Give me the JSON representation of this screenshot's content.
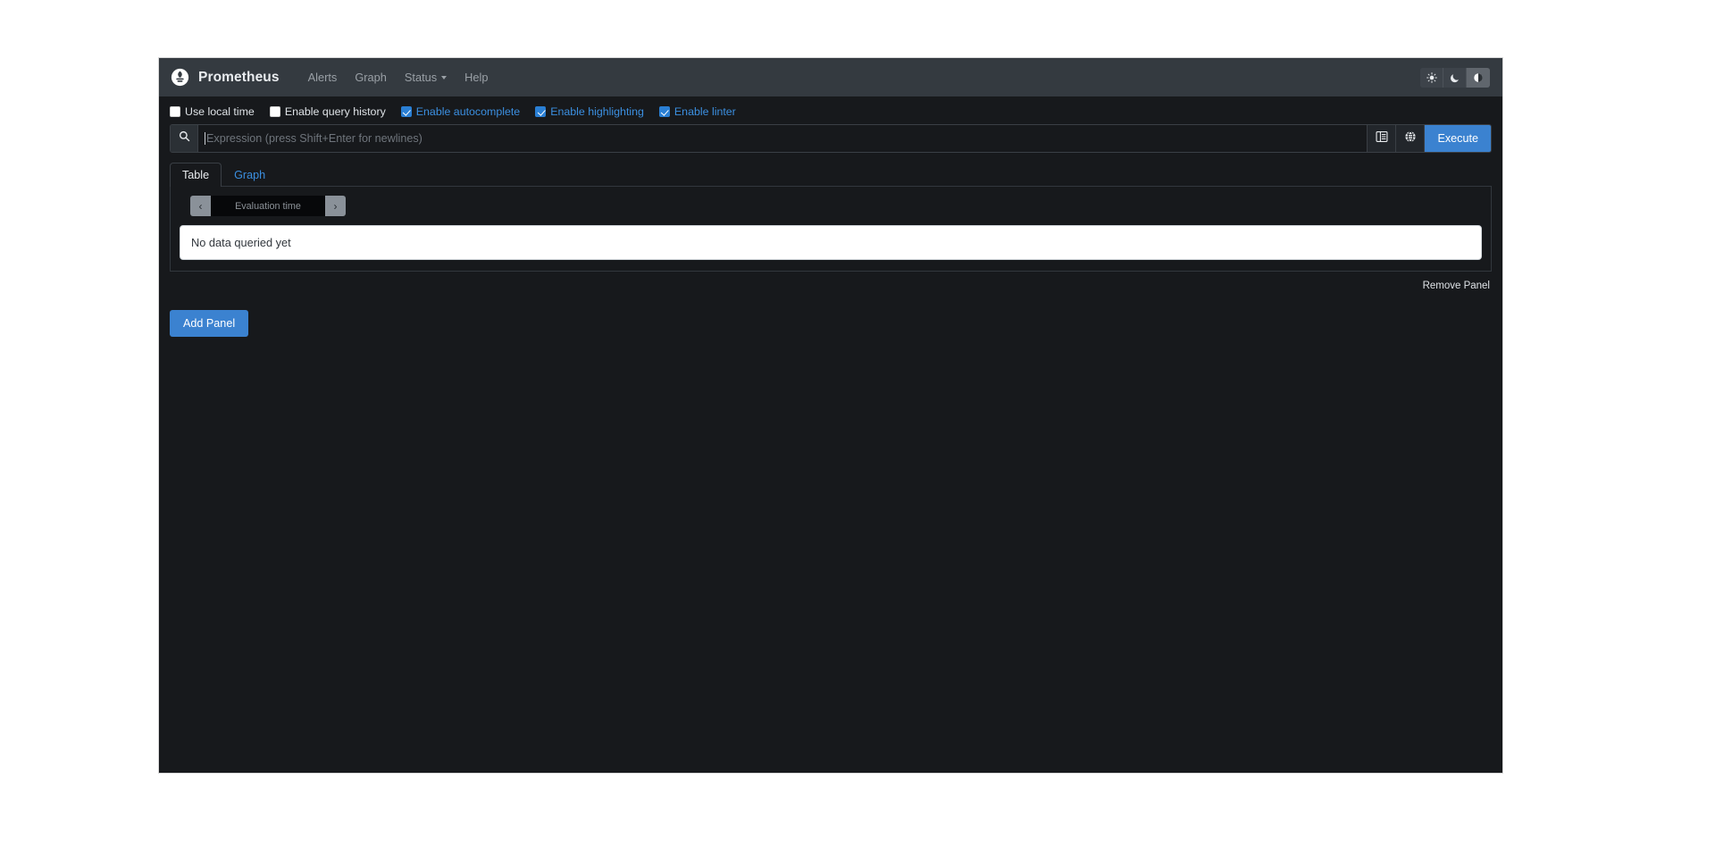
{
  "navbar": {
    "logo_icon": "prometheus-logo-icon",
    "brand": "Prometheus",
    "links": [
      {
        "label": "Alerts",
        "name": "nav-link-alerts",
        "dropdown": false
      },
      {
        "label": "Graph",
        "name": "nav-link-graph",
        "dropdown": false
      },
      {
        "label": "Status",
        "name": "nav-link-status",
        "dropdown": true
      },
      {
        "label": "Help",
        "name": "nav-link-help",
        "dropdown": false
      }
    ],
    "theme_buttons": [
      {
        "icon": "sun-icon",
        "name": "theme-light-button",
        "active": false
      },
      {
        "icon": "moon-icon",
        "name": "theme-dark-button",
        "active": false
      },
      {
        "icon": "half-circle-icon",
        "name": "theme-auto-button",
        "active": true
      }
    ]
  },
  "settings": {
    "options": [
      {
        "label": "Use local time",
        "checked": false
      },
      {
        "label": "Enable query history",
        "checked": false
      },
      {
        "label": "Enable autocomplete",
        "checked": true
      },
      {
        "label": "Enable highlighting",
        "checked": true
      },
      {
        "label": "Enable linter",
        "checked": true
      }
    ]
  },
  "expression": {
    "search_icon": "search-icon",
    "placeholder": "Expression (press Shift+Enter for newlines)",
    "value": "",
    "metrics_explorer_icon": "metrics-explorer-icon",
    "globe_icon": "globe-icon",
    "execute_label": "Execute"
  },
  "panel": {
    "tabs": [
      {
        "label": "Table",
        "active": true
      },
      {
        "label": "Graph",
        "active": false
      }
    ],
    "evaluation_time": {
      "prev_label": "‹",
      "placeholder": "Evaluation time",
      "value": "",
      "next_label": "›"
    },
    "alert_text": "No data queried yet",
    "remove_panel_label": "Remove Panel"
  },
  "footer": {
    "add_panel_label": "Add Panel"
  },
  "colors": {
    "navbar_bg": "#343a40",
    "body_bg": "#17191c",
    "accent_blue": "#3b82d0",
    "link_blue": "#3b8fe0",
    "muted_text": "#9aa0a6"
  }
}
